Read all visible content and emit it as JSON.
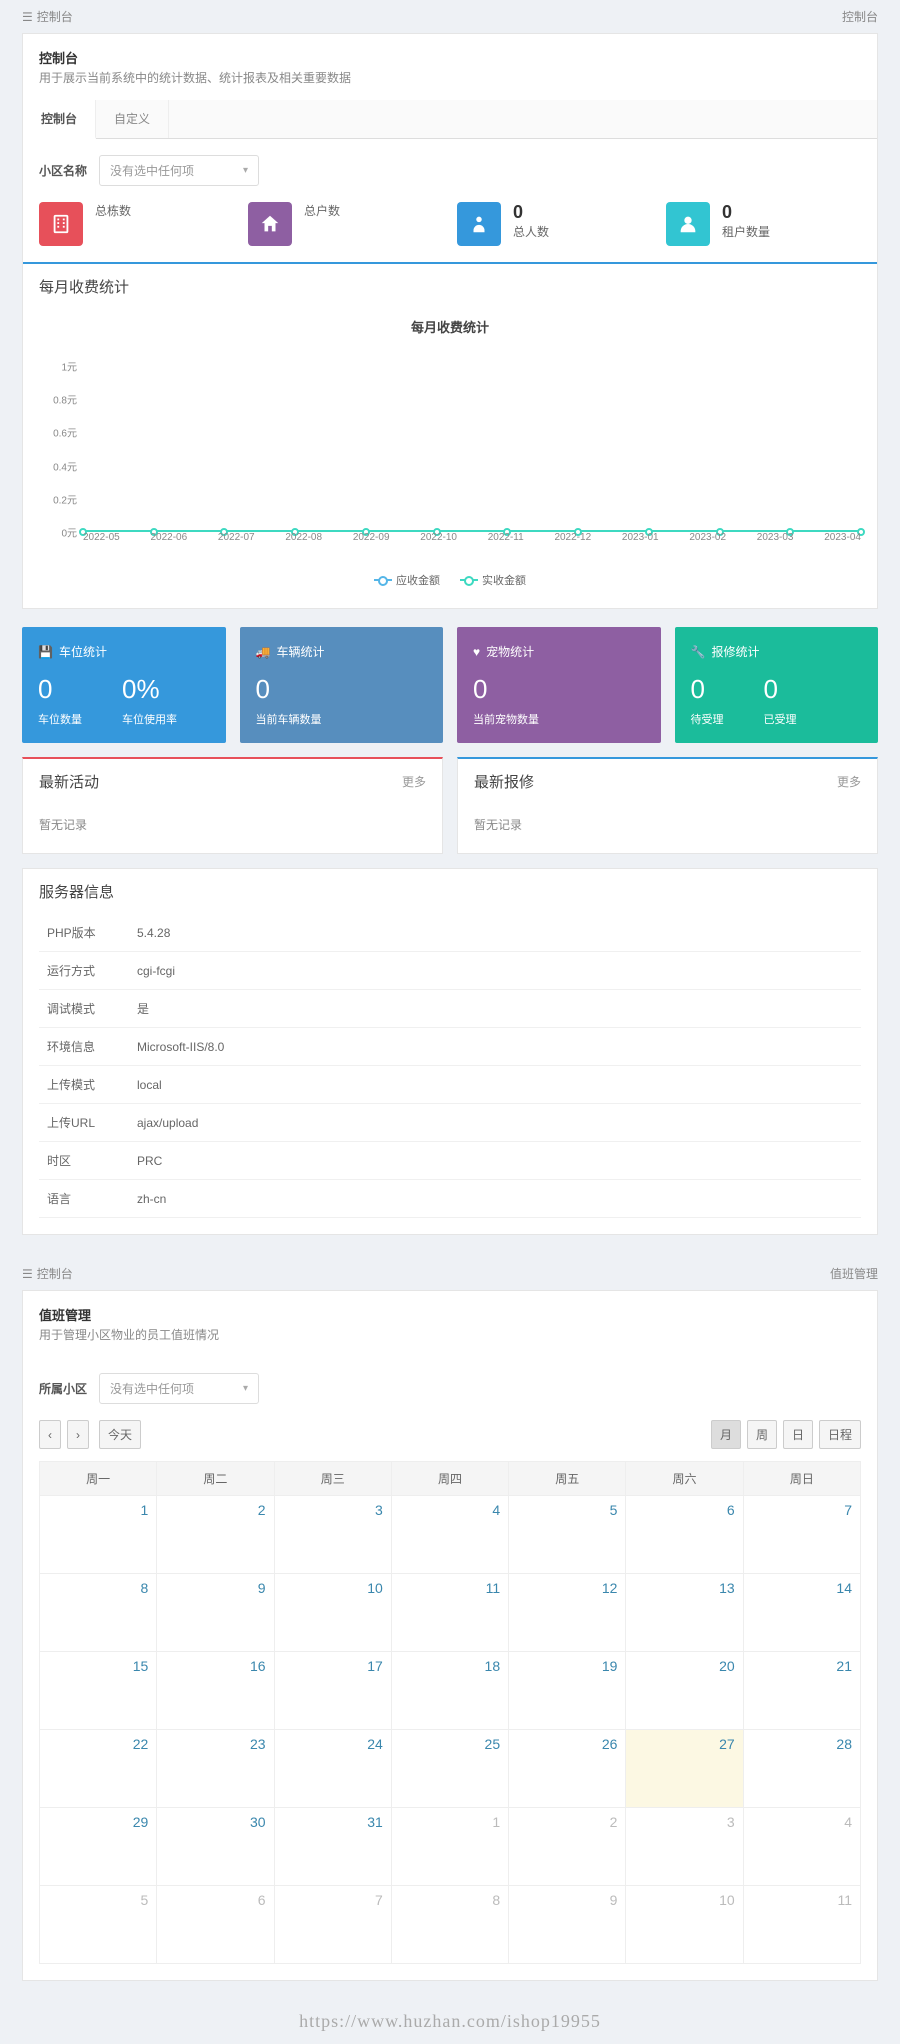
{
  "breadcrumb1": {
    "icon": "dashboard",
    "title": "控制台",
    "right": "控制台"
  },
  "page1": {
    "title": "控制台",
    "subtitle": "用于展示当前系统中的统计数据、统计报表及相关重要数据"
  },
  "tabs1": {
    "tab1": "控制台",
    "tab2": "自定义"
  },
  "filter1": {
    "label": "小区名称",
    "placeholder": "没有选中任何项"
  },
  "stats": [
    {
      "value": "",
      "label": "总栋数",
      "color": "red"
    },
    {
      "value": "",
      "label": "总户数",
      "color": "purple"
    },
    {
      "value": "0",
      "label": "总人数",
      "color": "blue"
    },
    {
      "value": "0",
      "label": "租户数量",
      "color": "green"
    }
  ],
  "monthly_title": "每月收费统计",
  "chart_data": {
    "type": "line",
    "title": "每月收费统计",
    "xlabel": "",
    "ylabel": "",
    "categories": [
      "2022-05",
      "2022-06",
      "2022-07",
      "2022-08",
      "2022-09",
      "2022-10",
      "2022-11",
      "2022-12",
      "2023-01",
      "2023-02",
      "2023-03",
      "2023-04"
    ],
    "y_ticks": [
      "0元",
      "0.2元",
      "0.4元",
      "0.6元",
      "0.8元",
      "1元"
    ],
    "ylim": [
      0,
      1
    ],
    "series": [
      {
        "name": "应收金额",
        "values": [
          0,
          0,
          0,
          0,
          0,
          0,
          0,
          0,
          0,
          0,
          0,
          0
        ],
        "color": "#55b6e8"
      },
      {
        "name": "实收金额",
        "values": [
          0,
          0,
          0,
          0,
          0,
          0,
          0,
          0,
          0,
          0,
          0,
          0
        ],
        "color": "#3dd9c1"
      }
    ]
  },
  "widgets": [
    {
      "color": "blue",
      "icon": "save",
      "title": "车位统计",
      "metrics": [
        {
          "n": "0",
          "l": "车位数量"
        },
        {
          "n": "0%",
          "l": "车位使用率"
        }
      ]
    },
    {
      "color": "blue2",
      "icon": "truck",
      "title": "车辆统计",
      "metrics": [
        {
          "n": "0",
          "l": "当前车辆数量"
        }
      ]
    },
    {
      "color": "purple",
      "icon": "heart",
      "title": "宠物统计",
      "metrics": [
        {
          "n": "0",
          "l": "当前宠物数量"
        }
      ]
    },
    {
      "color": "teal",
      "icon": "wrench",
      "title": "报修统计",
      "metrics": [
        {
          "n": "0",
          "l": "待受理"
        },
        {
          "n": "0",
          "l": "已受理"
        }
      ]
    }
  ],
  "latest_activity": {
    "title": "最新活动",
    "more": "更多",
    "empty": "暂无记录"
  },
  "latest_repair": {
    "title": "最新报修",
    "more": "更多",
    "empty": "暂无记录"
  },
  "server_info": {
    "title": "服务器信息",
    "rows": [
      {
        "k": "PHP版本",
        "v": "5.4.28"
      },
      {
        "k": "运行方式",
        "v": "cgi-fcgi"
      },
      {
        "k": "调试模式",
        "v": "是"
      },
      {
        "k": "环境信息",
        "v": "Microsoft-IIS/8.0"
      },
      {
        "k": "上传模式",
        "v": "local"
      },
      {
        "k": "上传URL",
        "v": "ajax/upload"
      },
      {
        "k": "时区",
        "v": "PRC"
      },
      {
        "k": "语言",
        "v": "zh-cn"
      }
    ]
  },
  "breadcrumb2": {
    "icon": "dashboard",
    "title": "控制台",
    "right": "值班管理"
  },
  "page2": {
    "title": "值班管理",
    "subtitle": "用于管理小区物业的员工值班情况"
  },
  "filter2": {
    "label": "所属小区",
    "placeholder": "没有选中任何项"
  },
  "calendar": {
    "nav": {
      "prev": "‹",
      "next": "›",
      "today": "今天"
    },
    "views": {
      "month": "月",
      "week": "周",
      "day": "日",
      "list": "日程"
    },
    "weekdays": [
      "周一",
      "周二",
      "周三",
      "周四",
      "周五",
      "周六",
      "周日"
    ],
    "today_day": 27,
    "weeks": [
      [
        {
          "d": 1
        },
        {
          "d": 2
        },
        {
          "d": 3
        },
        {
          "d": 4
        },
        {
          "d": 5
        },
        {
          "d": 6
        },
        {
          "d": 7
        }
      ],
      [
        {
          "d": 8
        },
        {
          "d": 9
        },
        {
          "d": 10
        },
        {
          "d": 11
        },
        {
          "d": 12
        },
        {
          "d": 13
        },
        {
          "d": 14
        }
      ],
      [
        {
          "d": 15
        },
        {
          "d": 16
        },
        {
          "d": 17
        },
        {
          "d": 18
        },
        {
          "d": 19
        },
        {
          "d": 20
        },
        {
          "d": 21
        }
      ],
      [
        {
          "d": 22
        },
        {
          "d": 23
        },
        {
          "d": 24
        },
        {
          "d": 25
        },
        {
          "d": 26
        },
        {
          "d": 27,
          "today": true
        },
        {
          "d": 28
        }
      ],
      [
        {
          "d": 29
        },
        {
          "d": 30
        },
        {
          "d": 31
        },
        {
          "d": 1,
          "other": true
        },
        {
          "d": 2,
          "other": true
        },
        {
          "d": 3,
          "other": true
        },
        {
          "d": 4,
          "other": true
        }
      ],
      [
        {
          "d": 5,
          "other": true
        },
        {
          "d": 6,
          "other": true
        },
        {
          "d": 7,
          "other": true
        },
        {
          "d": 8,
          "other": true
        },
        {
          "d": 9,
          "other": true
        },
        {
          "d": 10,
          "other": true
        },
        {
          "d": 11,
          "other": true
        }
      ]
    ]
  },
  "watermark": "https://www.huzhan.com/ishop19955"
}
